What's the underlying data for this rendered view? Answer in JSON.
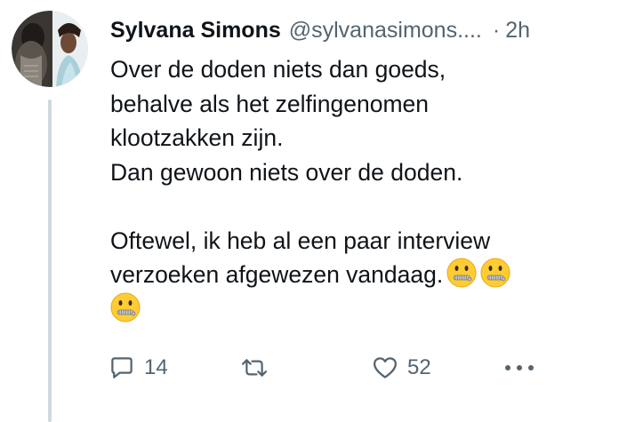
{
  "tweet": {
    "author_name": "Sylvana Simons",
    "handle": "@sylvanasimons....",
    "separator": "·",
    "time": "2h",
    "lines": [
      "Over de doden niets dan goeds,",
      "behalve als het zelfingenomen",
      "klootzakken zijn.",
      "Dan gewoon niets over de doden.",
      "",
      "Oftewel, ik heb al een paar interview",
      "verzoeken afgewezen vandaag."
    ],
    "emoji": "zipper-mouth-face",
    "emoji_count": 3
  },
  "actions": {
    "reply_count": "14",
    "retweet_count": "",
    "like_count": "52"
  },
  "icons": {
    "reply": "reply-icon",
    "retweet": "retweet-icon",
    "like": "heart-icon",
    "more": "more-icon"
  },
  "colors": {
    "text": "#0f1419",
    "secondary": "#536471",
    "thread_line": "#cfd9de",
    "emoji_face": "#ffcc33"
  }
}
